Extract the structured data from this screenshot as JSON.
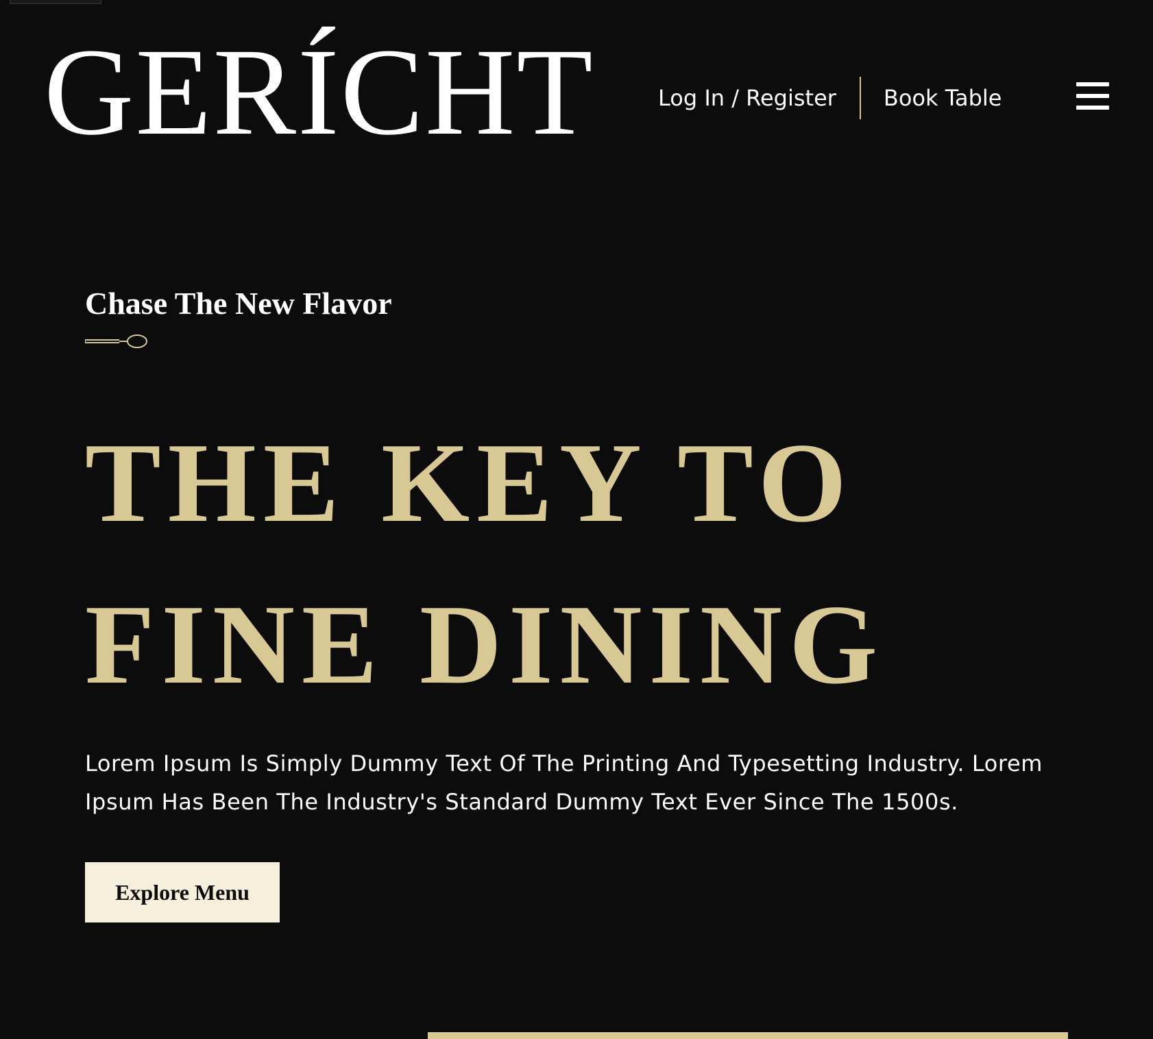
{
  "navbar": {
    "logo": "GERÍCHT",
    "login_label": "Log In / Register",
    "book_label": "Book Table",
    "menu_icon": "hamburger-menu-icon"
  },
  "hero": {
    "subtitle": "Chase The New Flavor",
    "subtitle_icon": "spoon-icon",
    "headline_line1": "THE KEY TO",
    "headline_line2": "FINE DINING",
    "description": "Lorem Ipsum Is Simply Dummy Text Of The Printing And Typesetting Industry. Lorem Ipsum Has Been The Industry's Standard Dummy Text Ever Since The 1500s.",
    "button_label": "Explore Menu"
  },
  "colors": {
    "background": "#0c0c0c",
    "gold": "#d8c994",
    "cream": "#f5efdb",
    "white": "#ffffff"
  }
}
